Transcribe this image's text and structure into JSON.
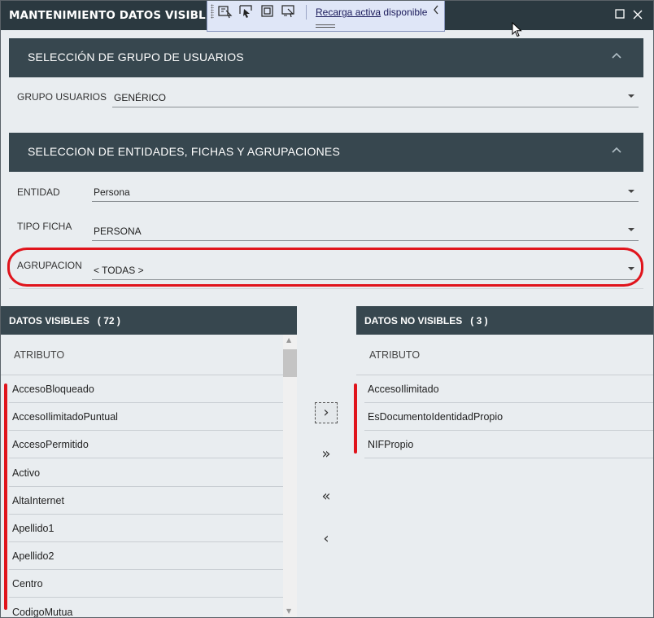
{
  "window": {
    "title": "MANTENIMIENTO DATOS VISIBLES",
    "maximize_icon": "maximize-icon",
    "close_icon": "close-icon"
  },
  "toolbar": {
    "link_text": "Recarga activa",
    "status_text": "disponible",
    "icons": [
      "select-element-icon",
      "pointer-select-icon",
      "frame-icon",
      "layout-adorner-icon"
    ],
    "collapse_icon": "chevron-left-icon"
  },
  "group_section": {
    "title": "SELECCIÓN DE GRUPO DE USUARIOS",
    "field_label": "GRUPO USUARIOS",
    "field_value": "GENÉRICO"
  },
  "entity_section": {
    "title": "SELECCION DE ENTIDADES, FICHAS Y AGRUPACIONES",
    "entity_label": "ENTIDAD",
    "entity_value": "Persona",
    "tipo_label": "TIPO FICHA",
    "tipo_value": "PERSONA",
    "agrup_label": "AGRUPACION",
    "agrup_value": "< TODAS >"
  },
  "visible_panel": {
    "title": "DATOS VISIBLES   ( 72 )",
    "column_header": "ATRIBUTO",
    "rows": [
      "AccesoBloqueado",
      "AccesoIlimitadoPuntual",
      "AccesoPermitido",
      "Activo",
      "AltaInternet",
      "Apellido1",
      "Apellido2",
      "Centro",
      "CodigoMutua"
    ]
  },
  "not_visible_panel": {
    "title": "DATOS NO VISIBLES   ( 3 )",
    "column_header": "ATRIBUTO",
    "rows": [
      "AccesoIlimitado",
      "EsDocumentoIdentidadPropio",
      "NIFPropio"
    ]
  },
  "move_buttons": {
    "move_right": "›",
    "move_all_right": "»",
    "move_all_left": "«",
    "move_left": "‹"
  },
  "colors": {
    "header_bg": "#37474f",
    "titlebar_bg": "#2b3940",
    "panel_bg": "#e9edf0",
    "annotation_red": "#e0141c"
  }
}
